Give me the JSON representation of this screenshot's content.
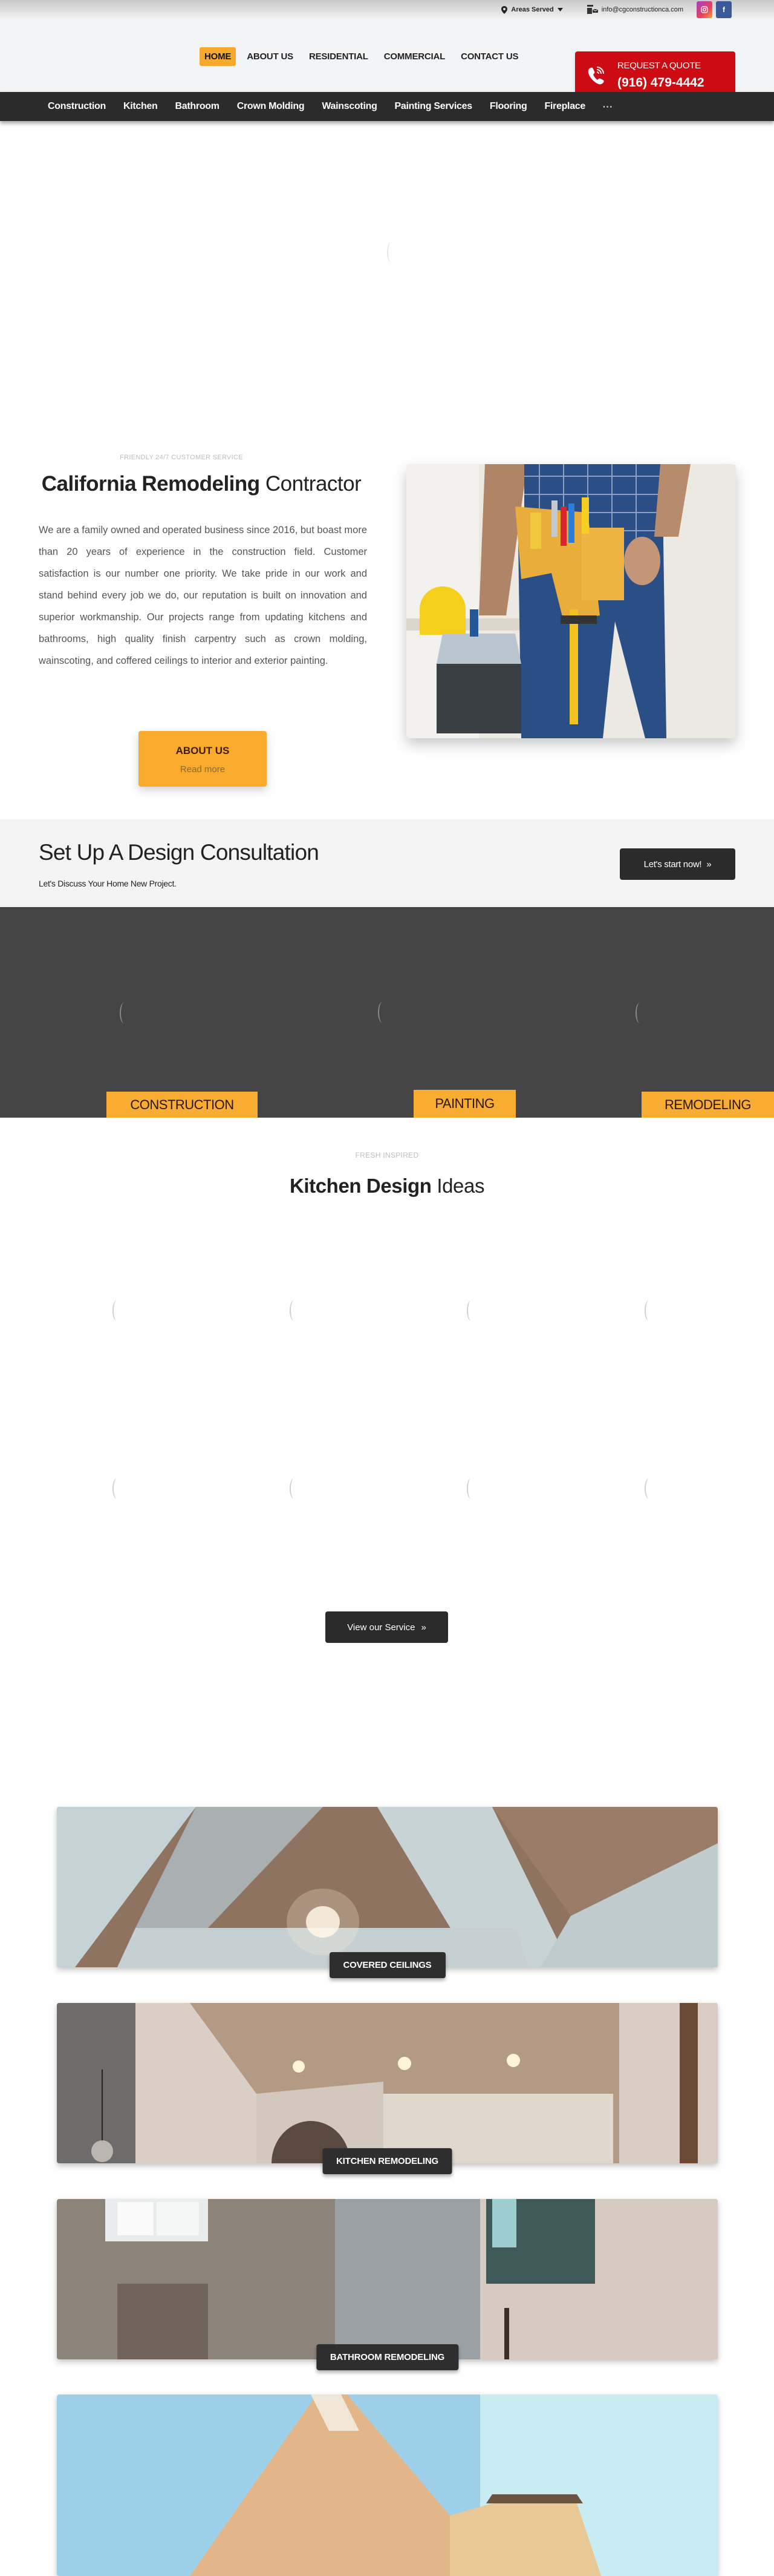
{
  "topbar": {
    "areas_label": "Areas Served",
    "email": "info@cgconstructionca.com",
    "social": [
      {
        "name": "instagram",
        "icon": "instagram-icon"
      },
      {
        "name": "facebook",
        "icon": "facebook-icon"
      }
    ]
  },
  "header": {
    "nav": [
      "HOME",
      "ABOUT US",
      "RESIDENTIAL",
      "COMMERCIAL",
      "CONTACT US"
    ],
    "active_nav": "HOME",
    "quote": {
      "label": "REQUEST A QUOTE",
      "phone": "(916) 479-4442"
    }
  },
  "subnav": {
    "items": [
      "Construction",
      "Kitchen",
      "Bathroom",
      "Crown Molding",
      "Wainscoting",
      "Painting Services",
      "Flooring",
      "Fireplace"
    ],
    "more": "···"
  },
  "about": {
    "eyebrow": "FRIENDLY 24/7 CUSTOMER SERVICE",
    "title_bold": "California Remodeling",
    "title_rest": " Contractor",
    "body": "We are a family owned and operated business since 2016, but boast more than 20 years of experience in the construction field. Customer satisfaction is our number one priority. We take pride in our work and stand behind every job we do, our reputation is built on innovation and superior workmanship. Our projects range from updating kitchens and bathrooms, high quality finish carpentry such as crown molding, wainscoting, and coffered ceilings to interior and exterior painting.",
    "button_title": "ABOUT US",
    "button_sub": "Read more",
    "image_alt": "Contractor with tool belt and toolbox"
  },
  "consultation": {
    "title": "Set Up A Design Consultation",
    "subtitle": "Let's Discuss Your Home New Project.",
    "button": "Let's start now!"
  },
  "services": {
    "tags": [
      "CONSTRUCTION",
      "PAINTING",
      "REMODELING"
    ]
  },
  "ideas": {
    "eyebrow": "FRESH INSPIRED",
    "title_bold": "Kitchen Design",
    "title_rest": " Ideas",
    "button": "View our Service"
  },
  "gallery": [
    {
      "label": "COVERED CEILINGS"
    },
    {
      "label": "KITCHEN REMODELING"
    },
    {
      "label": "BATHROOM REMODELING"
    },
    {
      "label": ""
    }
  ],
  "colors": {
    "accent": "#f8ab2d",
    "quote_red": "#cc0b13",
    "dark": "#2b2b2b",
    "services_bg": "#454545"
  }
}
